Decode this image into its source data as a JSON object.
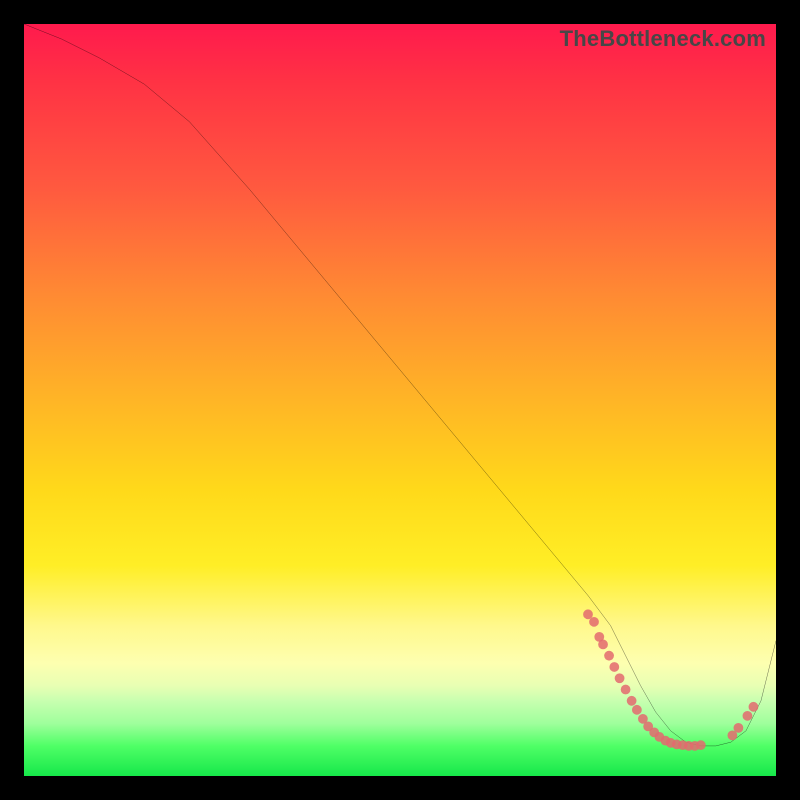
{
  "watermark": "TheBottleneck.com",
  "chart_data": {
    "type": "line",
    "title": "",
    "xlabel": "",
    "ylabel": "",
    "xlim": [
      0,
      100
    ],
    "ylim": [
      0,
      100
    ],
    "curve": {
      "x": [
        0,
        5,
        10,
        16,
        22,
        30,
        40,
        50,
        60,
        70,
        75,
        78,
        80,
        82,
        84,
        86,
        88,
        90,
        92,
        94,
        96,
        98,
        100
      ],
      "y": [
        100,
        98,
        95.5,
        92,
        87,
        78,
        66,
        54,
        42,
        30,
        24,
        20,
        16,
        12,
        8.5,
        6,
        4.5,
        4,
        4,
        4.5,
        6,
        10,
        18
      ]
    },
    "scatter_clusters": [
      {
        "x_range": [
          75,
          90
        ],
        "y_range": [
          5,
          22
        ],
        "density": "high"
      },
      {
        "x_range": [
          94,
          97
        ],
        "y_range": [
          6,
          10
        ],
        "density": "sparse"
      }
    ],
    "points": [
      {
        "x": 75.0,
        "y": 21.5
      },
      {
        "x": 75.8,
        "y": 20.5
      },
      {
        "x": 76.5,
        "y": 18.5
      },
      {
        "x": 77.0,
        "y": 17.5
      },
      {
        "x": 77.8,
        "y": 16.0
      },
      {
        "x": 78.5,
        "y": 14.5
      },
      {
        "x": 79.2,
        "y": 13.0
      },
      {
        "x": 80.0,
        "y": 11.5
      },
      {
        "x": 80.8,
        "y": 10.0
      },
      {
        "x": 81.5,
        "y": 8.8
      },
      {
        "x": 82.3,
        "y": 7.6
      },
      {
        "x": 83.0,
        "y": 6.6
      },
      {
        "x": 83.8,
        "y": 5.8
      },
      {
        "x": 84.5,
        "y": 5.2
      },
      {
        "x": 85.3,
        "y": 4.7
      },
      {
        "x": 86.0,
        "y": 4.4
      },
      {
        "x": 86.8,
        "y": 4.2
      },
      {
        "x": 87.6,
        "y": 4.1
      },
      {
        "x": 88.4,
        "y": 4.0
      },
      {
        "x": 89.2,
        "y": 4.0
      },
      {
        "x": 90.0,
        "y": 4.1
      },
      {
        "x": 94.2,
        "y": 5.4
      },
      {
        "x": 95.0,
        "y": 6.4
      },
      {
        "x": 96.2,
        "y": 8.0
      },
      {
        "x": 97.0,
        "y": 9.2
      }
    ],
    "gradient_stops": [
      {
        "pos": 0.0,
        "color": "#ff1a4d"
      },
      {
        "pos": 0.5,
        "color": "#ffd91a"
      },
      {
        "pos": 0.85,
        "color": "#fdffb0"
      },
      {
        "pos": 1.0,
        "color": "#16e74a"
      }
    ]
  }
}
